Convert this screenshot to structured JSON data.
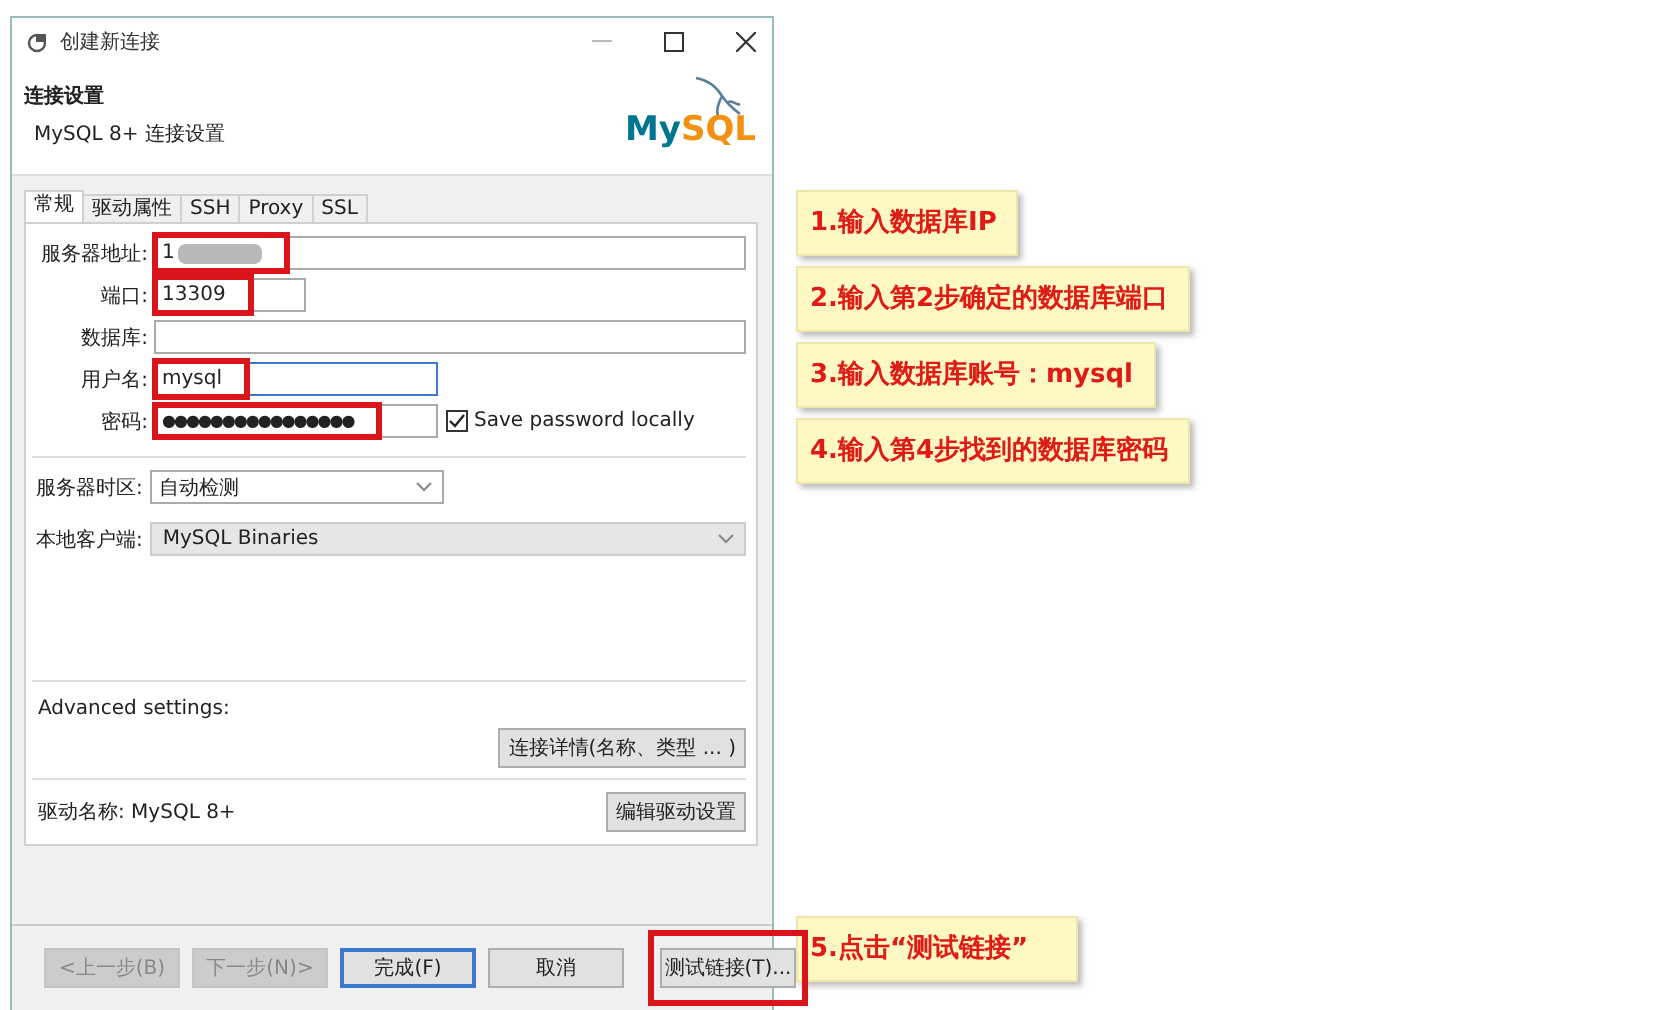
{
  "window": {
    "title": "创建新连接"
  },
  "header": {
    "title": "连接设置",
    "subtitle": "MySQL 8+ 连接设置",
    "logo_parts": [
      "My",
      "SQL"
    ]
  },
  "tabs": [
    {
      "label": "常规",
      "selected": true
    },
    {
      "label": "驱动属性",
      "selected": false
    },
    {
      "label": "SSH",
      "selected": false
    },
    {
      "label": "Proxy",
      "selected": false
    },
    {
      "label": "SSL",
      "selected": false
    }
  ],
  "fields": [
    {
      "kind": "host",
      "label": "服务器地址:",
      "value": "1",
      "redacted": true,
      "highlighted": true
    },
    {
      "kind": "port",
      "label": "端口:",
      "value": "13309",
      "redacted": false,
      "highlighted": true
    },
    {
      "kind": "database",
      "label": "数据库:",
      "redacted": false,
      "highlighted": false
    },
    {
      "kind": "user",
      "label": "用户名:",
      "value": "mysql",
      "redacted": false,
      "highlighted": true
    },
    {
      "kind": "password",
      "label": "密码:",
      "value": "●●●●●●●●●●●●●●●●",
      "redacted": false,
      "highlighted": true
    }
  ],
  "save_password": {
    "label": "Save password locally",
    "checked": true
  },
  "selects": [
    {
      "kind": "editable",
      "label": "服务器时区:",
      "value": "自动检测"
    },
    {
      "kind": "list",
      "label": "本地客户端:",
      "value": "MySQL Binaries"
    }
  ],
  "advanced": {
    "label": "Advanced settings:",
    "button": "连接详情(名称、类型 ... )"
  },
  "driver": {
    "label": "驱动名称: MySQL 8+",
    "button": "编辑驱动设置"
  },
  "footer_buttons": [
    {
      "label": "<上一步(B)",
      "disabled": true,
      "default": false,
      "highlighted": false
    },
    {
      "label": "下一步(N)>",
      "disabled": true,
      "default": false,
      "highlighted": false
    },
    {
      "label": "完成(F)",
      "disabled": false,
      "default": true,
      "highlighted": false
    },
    {
      "label": "取消",
      "disabled": false,
      "default": false,
      "highlighted": false
    },
    {
      "label": "测试链接(T)...",
      "disabled": false,
      "default": false,
      "highlighted": true
    }
  ],
  "steps": [
    "1.输入数据库IP",
    "2.输入第2步确定的数据库端口",
    "3.输入数据库账号：mysql",
    "4.输入第4步找到的数据库密码"
  ],
  "final_step": "5.点击“测试链接”"
}
